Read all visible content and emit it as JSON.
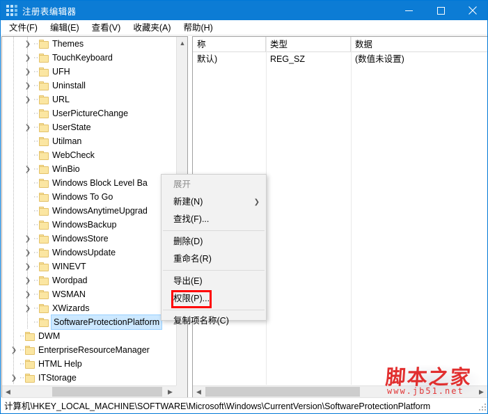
{
  "window": {
    "title": "注册表编辑器",
    "icon": "registry-grid-icon",
    "accent_color": "#0c7cd5",
    "controls": {
      "minimize": "minimize-icon",
      "maximize": "maximize-icon",
      "close": "close-icon"
    }
  },
  "menubar": {
    "items": [
      {
        "label": "文件(F)"
      },
      {
        "label": "编辑(E)"
      },
      {
        "label": "查看(V)"
      },
      {
        "label": "收藏夹(A)"
      },
      {
        "label": "帮助(H)"
      }
    ]
  },
  "tree": {
    "nodes": [
      {
        "label": "Themes",
        "expandable": true,
        "indent": 2,
        "selected": false
      },
      {
        "label": "TouchKeyboard",
        "expandable": true,
        "indent": 2,
        "selected": false
      },
      {
        "label": "UFH",
        "expandable": true,
        "indent": 2,
        "selected": false
      },
      {
        "label": "Uninstall",
        "expandable": true,
        "indent": 2,
        "selected": false
      },
      {
        "label": "URL",
        "expandable": true,
        "indent": 2,
        "selected": false
      },
      {
        "label": "UserPictureChange",
        "expandable": false,
        "indent": 2,
        "selected": false
      },
      {
        "label": "UserState",
        "expandable": true,
        "indent": 2,
        "selected": false
      },
      {
        "label": "Utilman",
        "expandable": false,
        "indent": 2,
        "selected": false
      },
      {
        "label": "WebCheck",
        "expandable": false,
        "indent": 2,
        "selected": false
      },
      {
        "label": "WinBio",
        "expandable": true,
        "indent": 2,
        "selected": false
      },
      {
        "label": "Windows Block Level Ba",
        "expandable": false,
        "indent": 2,
        "selected": false
      },
      {
        "label": "Windows To Go",
        "expandable": false,
        "indent": 2,
        "selected": false
      },
      {
        "label": "WindowsAnytimeUpgrad",
        "expandable": false,
        "indent": 2,
        "selected": false
      },
      {
        "label": "WindowsBackup",
        "expandable": false,
        "indent": 2,
        "selected": false
      },
      {
        "label": "WindowsStore",
        "expandable": true,
        "indent": 2,
        "selected": false
      },
      {
        "label": "WindowsUpdate",
        "expandable": true,
        "indent": 2,
        "selected": false
      },
      {
        "label": "WINEVT",
        "expandable": true,
        "indent": 2,
        "selected": false
      },
      {
        "label": "Wordpad",
        "expandable": true,
        "indent": 2,
        "selected": false
      },
      {
        "label": "WSMAN",
        "expandable": true,
        "indent": 2,
        "selected": false
      },
      {
        "label": "XWizards",
        "expandable": true,
        "indent": 2,
        "selected": false
      },
      {
        "label": "SoftwareProtectionPlatform",
        "expandable": false,
        "indent": 2,
        "selected": true
      },
      {
        "label": "DWM",
        "expandable": false,
        "indent": 1,
        "selected": false
      },
      {
        "label": "EnterpriseResourceManager",
        "expandable": true,
        "indent": 1,
        "selected": false
      },
      {
        "label": "HTML Help",
        "expandable": false,
        "indent": 1,
        "selected": false
      },
      {
        "label": "ITStorage",
        "expandable": true,
        "indent": 1,
        "selected": false
      }
    ]
  },
  "values": {
    "columns": [
      "称",
      "类型",
      "数据"
    ],
    "rows": [
      {
        "name": "默认)",
        "type": "REG_SZ",
        "data": "(数值未设置)"
      }
    ]
  },
  "context_menu": {
    "items": [
      {
        "label": "展开",
        "disabled": true,
        "submenu": false,
        "separator_after": false
      },
      {
        "label": "新建(N)",
        "disabled": false,
        "submenu": true,
        "separator_after": false
      },
      {
        "label": "查找(F)...",
        "disabled": false,
        "submenu": false,
        "separator_after": true
      },
      {
        "label": "删除(D)",
        "disabled": false,
        "submenu": false,
        "separator_after": false
      },
      {
        "label": "重命名(R)",
        "disabled": false,
        "submenu": false,
        "separator_after": true
      },
      {
        "label": "导出(E)",
        "disabled": false,
        "submenu": false,
        "separator_after": false
      },
      {
        "label": "权限(P)...",
        "disabled": false,
        "submenu": false,
        "separator_after": true,
        "highlighted": true
      },
      {
        "label": "复制项名称(C)",
        "disabled": false,
        "submenu": false,
        "separator_after": false
      }
    ],
    "highlight_color": "#ff0000"
  },
  "statusbar": {
    "path": "计算机\\HKEY_LOCAL_MACHINE\\SOFTWARE\\Microsoft\\Windows\\CurrentVersion\\SoftwareProtectionPlatform"
  },
  "watermark": {
    "text": "脚本之家",
    "url": "www.jb51.net",
    "color": "#e02020"
  }
}
